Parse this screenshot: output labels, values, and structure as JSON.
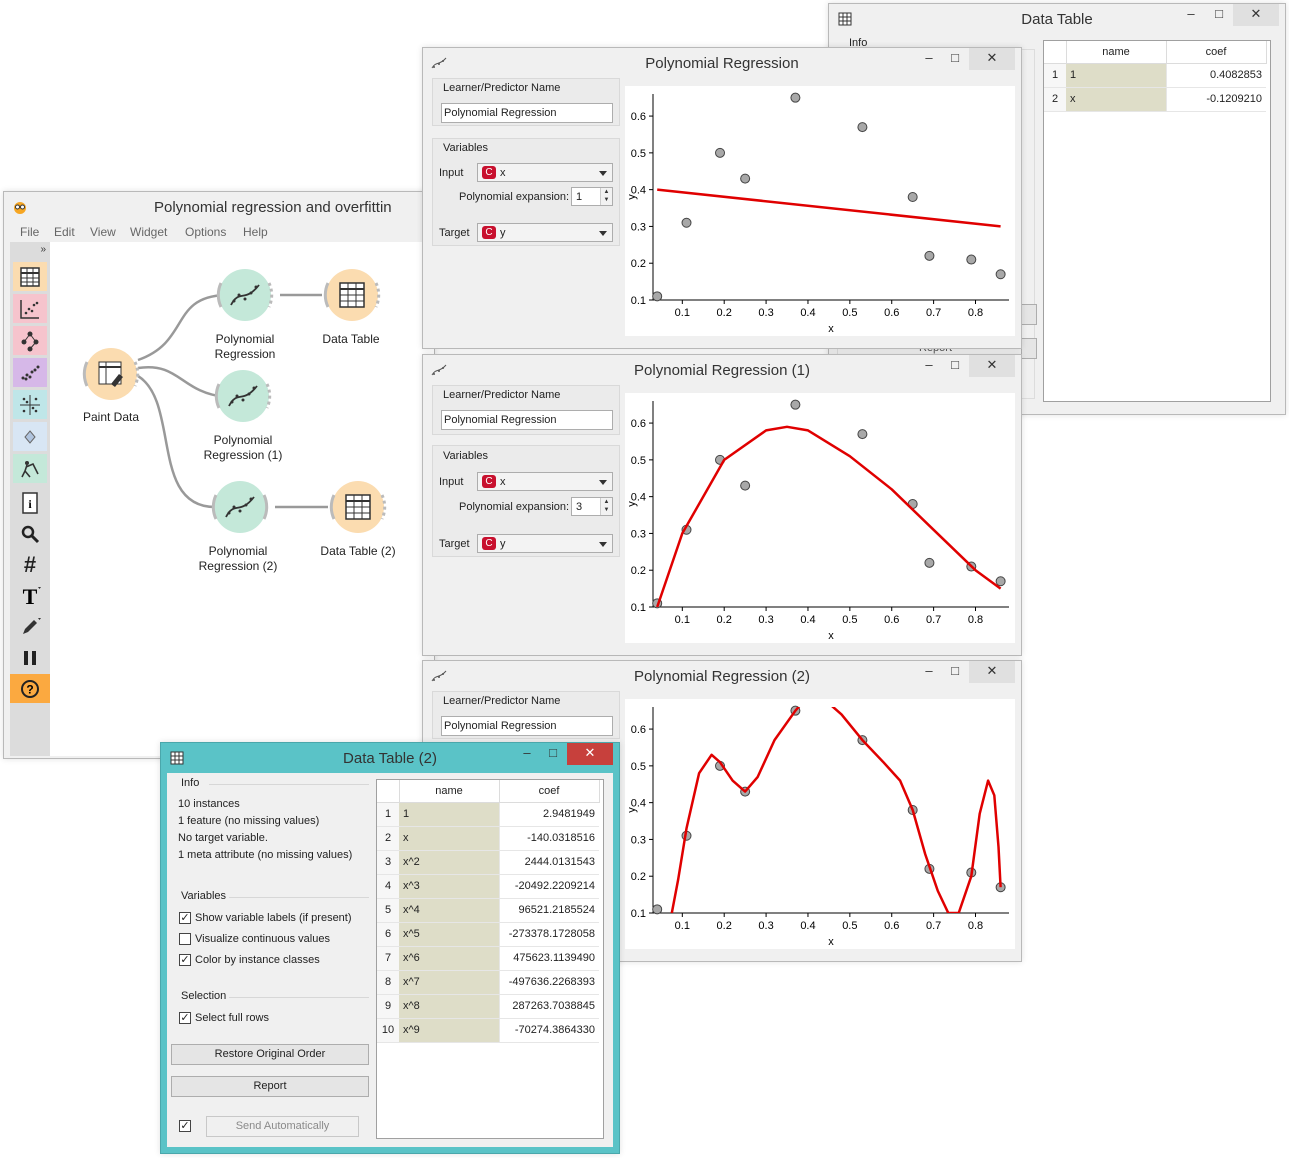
{
  "canvas_window": {
    "title": "Polynomial regression and overfittin",
    "menu": [
      "File",
      "Edit",
      "View",
      "Widget",
      "Options",
      "Help"
    ],
    "toolbox_expand": "»",
    "nodes": {
      "paint_data": "Paint Data",
      "poly1": [
        "Polynomial",
        "Regression"
      ],
      "poly2": [
        "Polynomial",
        "Regression (1)"
      ],
      "poly3": [
        "Polynomial",
        "Regression (2)"
      ],
      "table1": "Data Table",
      "table2": "Data Table (2)"
    },
    "colors": {
      "learner": "#c4e8d9",
      "data": "#fbdcb0",
      "link": "#999999",
      "help": "#fba940"
    }
  },
  "poly_windows": [
    {
      "title": "Polynomial Regression",
      "name_box": "Learner/Predictor Name",
      "name_value": "Polynomial Regression",
      "variables_box": "Variables",
      "input_label": "Input",
      "input_value": "x",
      "expansion_label": "Polynomial expansion:",
      "expansion_value": "1",
      "target_label": "Target",
      "target_value": "y",
      "var_badge": "C",
      "xlabel": "x",
      "ylabel": "y"
    },
    {
      "title": "Polynomial Regression (1)",
      "name_box": "Learner/Predictor Name",
      "name_value": "Polynomial Regression",
      "variables_box": "Variables",
      "input_label": "Input",
      "input_value": "x",
      "expansion_label": "Polynomial expansion:",
      "expansion_value": "3",
      "target_label": "Target",
      "target_value": "y",
      "var_badge": "C",
      "xlabel": "x",
      "ylabel": "y"
    },
    {
      "title": "Polynomial Regression (2)",
      "name_box": "Learner/Predictor Name",
      "name_value": "Polynomial Regression",
      "xlabel": "x",
      "ylabel": "y"
    }
  ],
  "chart_data": [
    {
      "type": "scatter",
      "xlabel": "x",
      "ylabel": "y",
      "xlim": [
        0.03,
        0.88
      ],
      "ylim": [
        0.1,
        0.66
      ],
      "xticks": [
        0.1,
        0.2,
        0.3,
        0.4,
        0.5,
        0.6,
        0.7,
        0.8
      ],
      "yticks": [
        0.1,
        0.2,
        0.3,
        0.4,
        0.5,
        0.6
      ],
      "points": {
        "x": [
          0.04,
          0.11,
          0.19,
          0.25,
          0.37,
          0.53,
          0.65,
          0.69,
          0.79,
          0.86
        ],
        "y": [
          0.11,
          0.31,
          0.5,
          0.43,
          0.65,
          0.57,
          0.38,
          0.22,
          0.21,
          0.17
        ]
      },
      "fit": {
        "x": [
          0.04,
          0.86
        ],
        "y": [
          0.4,
          0.3
        ]
      },
      "fit_color": "#e00000"
    },
    {
      "type": "scatter",
      "xlabel": "x",
      "ylabel": "y",
      "xlim": [
        0.03,
        0.88
      ],
      "ylim": [
        0.1,
        0.66
      ],
      "xticks": [
        0.1,
        0.2,
        0.3,
        0.4,
        0.5,
        0.6,
        0.7,
        0.8
      ],
      "yticks": [
        0.1,
        0.2,
        0.3,
        0.4,
        0.5,
        0.6
      ],
      "points": {
        "x": [
          0.04,
          0.11,
          0.19,
          0.25,
          0.37,
          0.53,
          0.65,
          0.69,
          0.79,
          0.86
        ],
        "y": [
          0.11,
          0.31,
          0.5,
          0.43,
          0.65,
          0.57,
          0.38,
          0.22,
          0.21,
          0.17
        ]
      },
      "fit": {
        "x": [
          0.04,
          0.1,
          0.2,
          0.3,
          0.35,
          0.4,
          0.5,
          0.6,
          0.7,
          0.8,
          0.86
        ],
        "y": [
          0.1,
          0.3,
          0.5,
          0.58,
          0.59,
          0.58,
          0.51,
          0.42,
          0.31,
          0.2,
          0.15
        ]
      },
      "fit_color": "#e00000"
    },
    {
      "type": "scatter",
      "xlabel": "x",
      "ylabel": "y",
      "xlim": [
        0.03,
        0.88
      ],
      "ylim": [
        0.1,
        0.66
      ],
      "xticks": [
        0.1,
        0.2,
        0.3,
        0.4,
        0.5,
        0.6,
        0.7,
        0.8
      ],
      "yticks": [
        0.1,
        0.2,
        0.3,
        0.4,
        0.5,
        0.6
      ],
      "points": {
        "x": [
          0.04,
          0.11,
          0.19,
          0.25,
          0.37,
          0.53,
          0.65,
          0.69,
          0.79,
          0.86
        ],
        "y": [
          0.11,
          0.31,
          0.5,
          0.43,
          0.65,
          0.57,
          0.38,
          0.22,
          0.21,
          0.17
        ]
      },
      "fit": {
        "x": [
          0.075,
          0.09,
          0.11,
          0.14,
          0.17,
          0.19,
          0.22,
          0.25,
          0.28,
          0.32,
          0.37,
          0.4,
          0.43,
          0.48,
          0.53,
          0.58,
          0.62,
          0.65,
          0.68,
          0.71,
          0.735,
          0.76,
          0.79,
          0.81,
          0.83,
          0.845,
          0.855,
          0.86
        ],
        "y": [
          0.1,
          0.19,
          0.33,
          0.48,
          0.53,
          0.51,
          0.46,
          0.43,
          0.47,
          0.57,
          0.65,
          0.69,
          0.69,
          0.64,
          0.57,
          0.51,
          0.46,
          0.38,
          0.26,
          0.16,
          0.1,
          0.1,
          0.2,
          0.37,
          0.46,
          0.42,
          0.28,
          0.17
        ]
      },
      "fit_color": "#e00000"
    }
  ],
  "data_table_top": {
    "title": "Data Table",
    "info_label": "Info",
    "partial_label": "Report",
    "columns": [
      "name",
      "coef"
    ],
    "rows": [
      {
        "num": "1",
        "name": "1",
        "coef": "0.4082853"
      },
      {
        "num": "2",
        "name": "x",
        "coef": "-0.1209210"
      }
    ]
  },
  "data_table_2": {
    "title": "Data Table (2)",
    "info_label": "Info",
    "info_lines": [
      "10 instances",
      "1 feature (no missing values)",
      "No target variable.",
      "1 meta attribute (no missing values)"
    ],
    "variables_label": "Variables",
    "checks": [
      {
        "label": "Show variable labels (if present)",
        "checked": true
      },
      {
        "label": "Visualize continuous values",
        "checked": false
      },
      {
        "label": "Color by instance classes",
        "checked": true
      }
    ],
    "selection_label": "Selection",
    "select_full_rows": "Select full rows",
    "restore_button": "Restore Original Order",
    "report_button": "Report",
    "send_auto_button": "Send Automatically",
    "columns": [
      "name",
      "coef"
    ],
    "rows": [
      {
        "num": "1",
        "name": "1",
        "coef": "2.9481949"
      },
      {
        "num": "2",
        "name": "x",
        "coef": "-140.0318516"
      },
      {
        "num": "3",
        "name": "x^2",
        "coef": "2444.0131543"
      },
      {
        "num": "4",
        "name": "x^3",
        "coef": "-20492.2209214"
      },
      {
        "num": "5",
        "name": "x^4",
        "coef": "96521.2185524"
      },
      {
        "num": "6",
        "name": "x^5",
        "coef": "-273378.1728058"
      },
      {
        "num": "7",
        "name": "x^6",
        "coef": "475623.1139490"
      },
      {
        "num": "8",
        "name": "x^7",
        "coef": "-497636.2268393"
      },
      {
        "num": "9",
        "name": "x^8",
        "coef": "287263.7038845"
      },
      {
        "num": "10",
        "name": "x^9",
        "coef": "-70274.3864330"
      }
    ]
  }
}
